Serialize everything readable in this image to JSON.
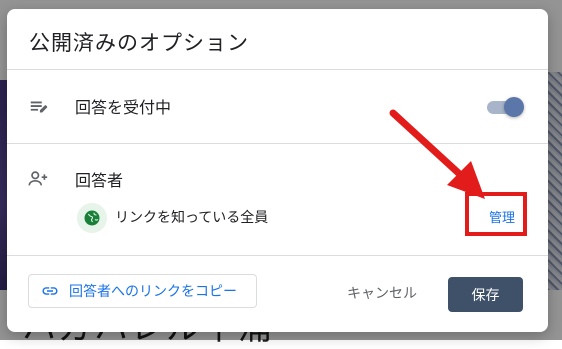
{
  "dialog": {
    "title": "公開済みのオプション",
    "accepting_responses": {
      "label": "回答を受付中",
      "icon": "list-edit-icon",
      "enabled": true
    },
    "respondents": {
      "label": "回答者",
      "icon": "person-add-icon",
      "access_text": "リンクを知っている全員",
      "access_icon": "globe-icon",
      "manage_label": "管理"
    },
    "copy_link_label": "回答者へのリンクをコピー",
    "copy_link_icon": "link-icon",
    "cancel_label": "キャンセル",
    "save_label": "保存"
  },
  "background": {
    "heading_fragment": "ハガハレル半浦"
  },
  "colors": {
    "link": "#1a73e8",
    "save_button": "#3f5168",
    "toggle_thumb": "#5b76a8",
    "highlight": "#e21b1b"
  }
}
